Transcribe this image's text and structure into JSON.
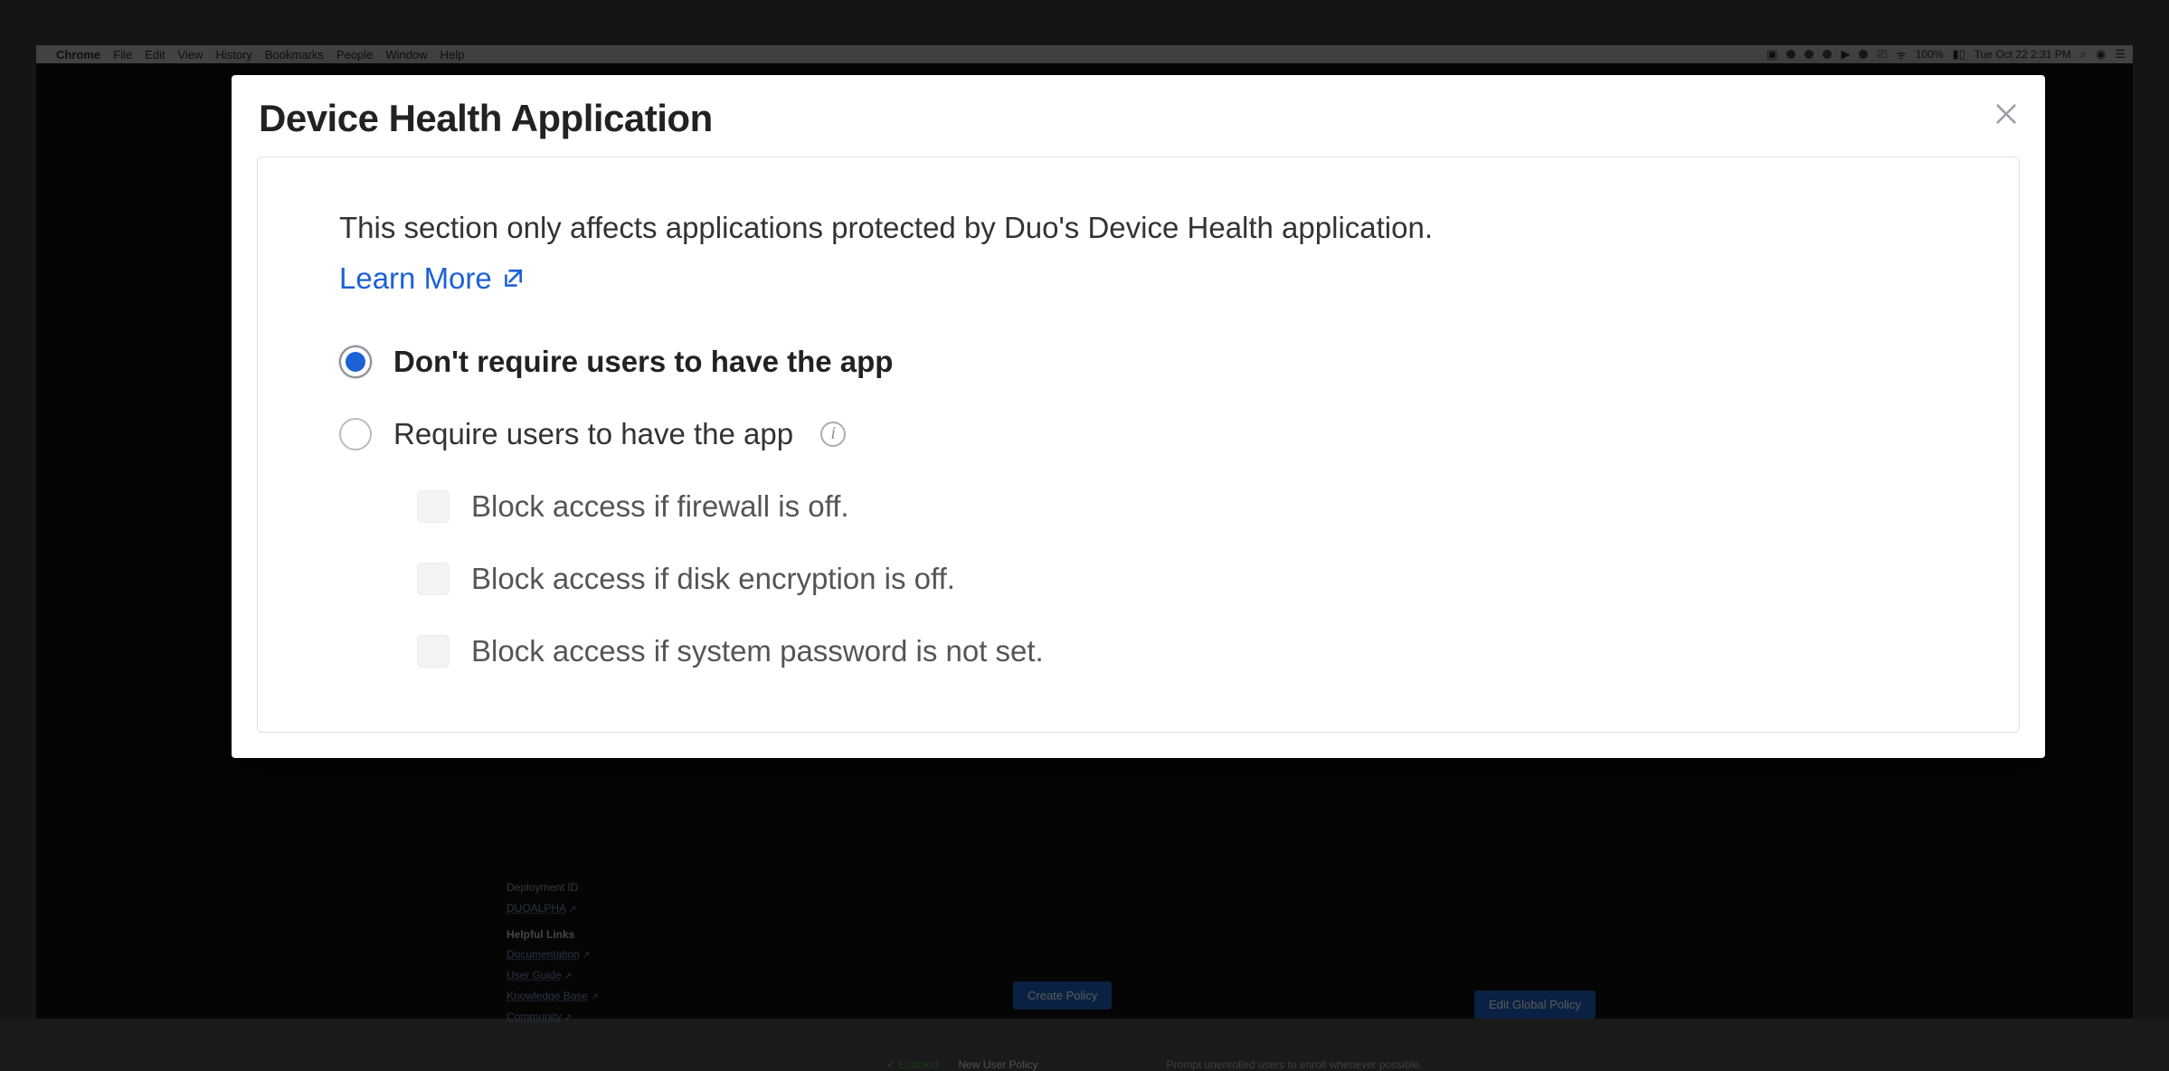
{
  "menubar": {
    "app": "Chrome",
    "items": [
      "File",
      "Edit",
      "View",
      "History",
      "Bookmarks",
      "People",
      "Window",
      "Help"
    ],
    "battery": "100%",
    "clock": "Tue Oct 22  2:31 PM"
  },
  "background": {
    "sidebar": {
      "deployment_label": "Deployment ID",
      "deployment_value": "DUOALPHA",
      "helpful_heading": "Helpful Links",
      "links": [
        "Documentation",
        "User Guide",
        "Knowledge Base",
        "Community"
      ]
    },
    "buttons": {
      "create": "Create Policy",
      "edit": "Edit Global Policy"
    },
    "status": {
      "enabled": "Enabled",
      "nup": "New User Policy",
      "prompt": "Prompt unenrolled users to enroll whenever possible."
    }
  },
  "modal": {
    "title": "Device Health Application",
    "intro": "This section only affects applications protected by Duo's Device Health application.",
    "learn_more": "Learn More",
    "option_dont_require": "Don't require users to have the app",
    "option_require": "Require users to have the app",
    "check_firewall": "Block access if firewall is off.",
    "check_disk": "Block access if disk encryption is off.",
    "check_password": "Block access if system password is not set."
  }
}
